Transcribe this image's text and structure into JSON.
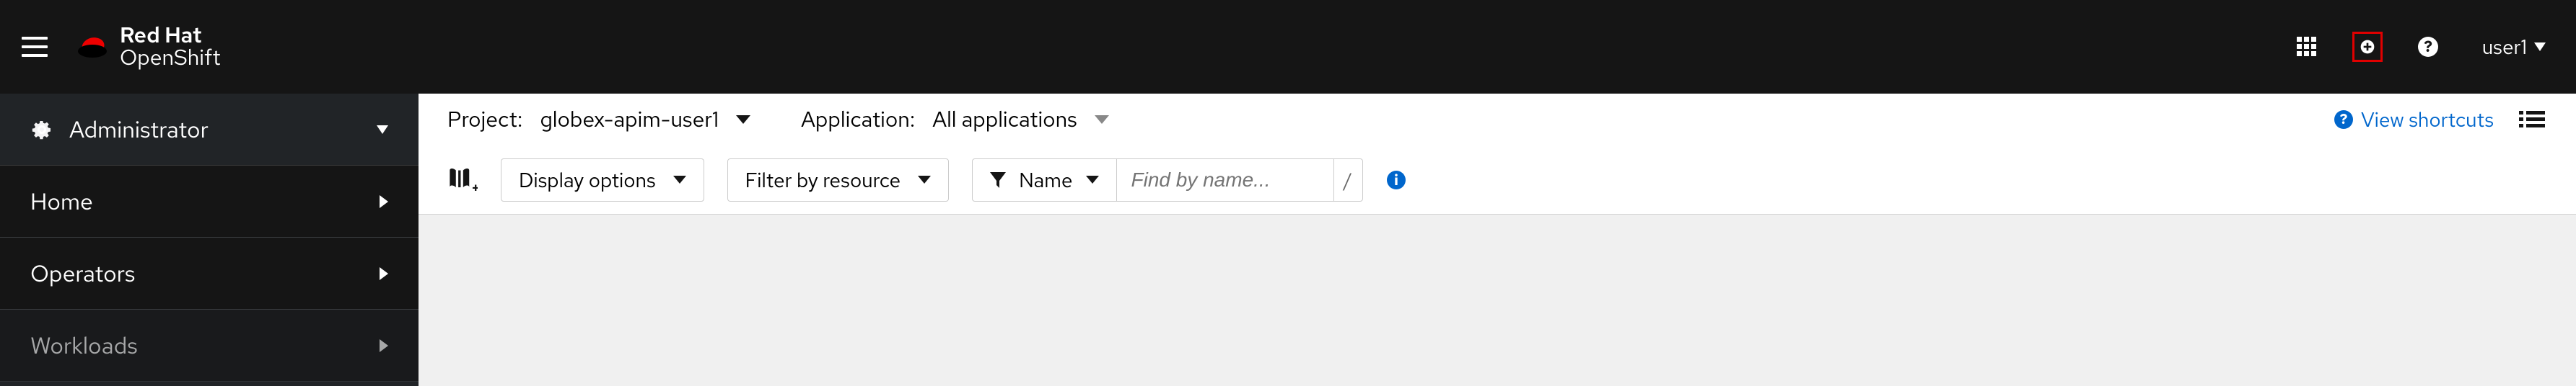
{
  "masthead": {
    "brand_line1": "Red Hat",
    "brand_line2": "OpenShift",
    "user": "user1"
  },
  "sidebar": {
    "perspective": "Administrator",
    "items": [
      {
        "label": "Home"
      },
      {
        "label": "Operators"
      },
      {
        "label": "Workloads"
      }
    ]
  },
  "project_bar": {
    "project_label": "Project:",
    "project_value": "globex-apim-user1",
    "app_label": "Application:",
    "app_value": "All applications",
    "shortcuts": "View shortcuts"
  },
  "toolbar": {
    "display_options": "Display options",
    "filter_by_resource": "Filter by resource",
    "name_label": "Name",
    "find_placeholder": "Find by name...",
    "slash": "/"
  }
}
